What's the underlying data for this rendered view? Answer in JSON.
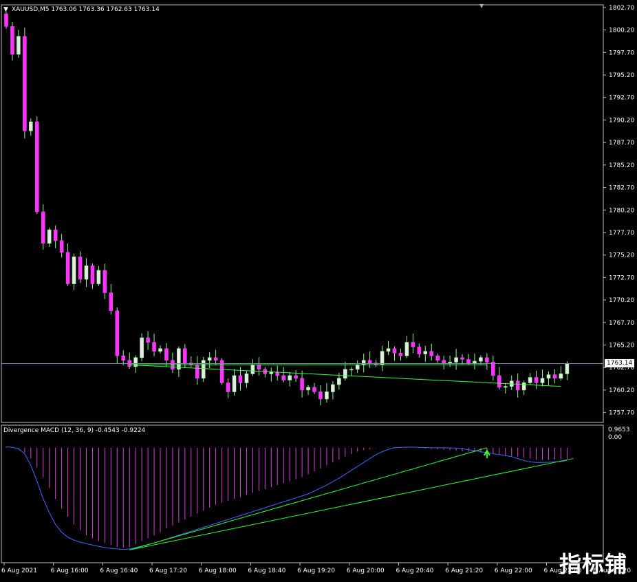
{
  "header": {
    "symbol_line": "XAUUSD,M5  1763.06 1763.36 1762.63 1763.14",
    "menu_icon": "triangle-down-icon"
  },
  "indicator": {
    "title": "Divergence MACD (12, 36, 9) -0.4543 -0.9224",
    "axis_top": "0.9653",
    "axis_zero": "0.00"
  },
  "price": {
    "current_label": "1763.14",
    "current_value": 1763.14
  },
  "watermark": "指标铺",
  "colors": {
    "bull": "#e8e8e8",
    "bull_outline": "#8cff8c",
    "bear": "#ff33ff",
    "wick": "#8cff8c",
    "trendline": "#33ff33",
    "signal": "#3d6bff",
    "histogram": "#e040e0",
    "price_line": "#7a8ca8",
    "arrow": "#33ff33",
    "frame": "#c0c0c0"
  },
  "chart_data": [
    {
      "type": "candlestick",
      "title": "XAUUSD,M5",
      "ylim": [
        1756.6,
        1803.0
      ],
      "yticks": [
        "1802.70",
        "1800.20",
        "1797.70",
        "1795.20",
        "1792.70",
        "1790.20",
        "1787.70",
        "1785.20",
        "1782.70",
        "1780.20",
        "1777.70",
        "1775.20",
        "1772.70",
        "1770.20",
        "1767.70",
        "1765.20",
        "1762.70",
        "1760.20",
        "1757.70"
      ],
      "xticks": [
        "6 Aug 2021",
        "6 Aug 16:00",
        "6 Aug 16:40",
        "6 Aug 17:20",
        "6 Aug 18:00",
        "6 Aug 18:40",
        "6 Aug 19:20",
        "6 Aug 20:00",
        "6 Aug 20:40",
        "6 Aug 21:20",
        "6 Aug 22:00",
        "6 Aug 22:40",
        "6 Aug 23:20"
      ],
      "closes": [
        1800.6,
        1797.5,
        1799.5,
        1789.0,
        1790.0,
        1780.0,
        1776.5,
        1778.0,
        1776.8,
        1775.5,
        1772.0,
        1775.0,
        1772.5,
        1774.0,
        1772.0,
        1773.5,
        1771.0,
        1769.0,
        1764.0,
        1763.5,
        1762.8,
        1763.8,
        1766.0,
        1765.5,
        1764.5,
        1764.8,
        1763.5,
        1762.5,
        1764.8,
        1763.2,
        1763.0,
        1761.5,
        1763.5,
        1763.8,
        1763.5,
        1761.0,
        1760.0,
        1761.8,
        1761.0,
        1762.0,
        1763.0,
        1762.5,
        1762.0,
        1762.2,
        1761.8,
        1761.3,
        1761.8,
        1761.5,
        1760.2,
        1760.5,
        1760.0,
        1759.2,
        1760.0,
        1760.8,
        1761.5,
        1762.5,
        1762.5,
        1763.0,
        1763.5,
        1763.2,
        1763.0,
        1764.5,
        1764.8,
        1764.3,
        1764.0,
        1765.5,
        1765.0,
        1764.2,
        1764.5,
        1764.0,
        1763.5,
        1763.2,
        1763.3,
        1763.8,
        1763.6,
        1763.2,
        1763.4,
        1763.8,
        1763.3,
        1761.8,
        1760.5,
        1760.6,
        1761.2,
        1760.2,
        1761.0,
        1761.6,
        1761.0,
        1761.5,
        1761.9,
        1761.5,
        1762.0,
        1763.14
      ],
      "trendlines": [
        {
          "from": [
            20,
            1763.0
          ],
          "to": [
            78,
            1763.0
          ]
        },
        {
          "from": [
            20,
            1763.0
          ],
          "to": [
            90,
            1760.6
          ]
        }
      ]
    },
    {
      "type": "macd",
      "title": "Divergence MACD (12, 36, 9)",
      "ylim": [
        -5.85,
        1.15
      ],
      "macd_histogram": [
        0.05,
        0.0,
        -0.08,
        -0.25,
        -0.55,
        -1.0,
        -1.5,
        -2.05,
        -2.6,
        -3.1,
        -3.5,
        -3.9,
        -4.2,
        -4.45,
        -4.6,
        -4.75,
        -4.85,
        -4.95,
        -5.05,
        -5.1,
        -5.05,
        -4.9,
        -4.75,
        -4.6,
        -4.45,
        -4.3,
        -4.1,
        -3.95,
        -3.8,
        -3.65,
        -3.5,
        -3.35,
        -3.2,
        -3.05,
        -2.9,
        -2.8,
        -2.7,
        -2.6,
        -2.5,
        -2.4,
        -2.3,
        -2.2,
        -2.1,
        -2.0,
        -1.9,
        -1.8,
        -1.7,
        -1.6,
        -1.5,
        -1.35,
        -1.2,
        -1.05,
        -0.9,
        -0.75,
        -0.6,
        -0.45,
        -0.32,
        -0.2,
        -0.12,
        -0.06,
        -0.02,
        0.0,
        0.02,
        0.03,
        0.03,
        0.02,
        0.0,
        -0.02,
        -0.04,
        -0.06,
        -0.08,
        -0.1,
        -0.12,
        -0.15,
        -0.18,
        -0.2,
        -0.22,
        -0.25,
        -0.27,
        -0.3,
        -0.35,
        -0.4,
        -0.42,
        -0.45,
        -0.5,
        -0.55,
        -0.6,
        -0.62,
        -0.62,
        -0.6,
        -0.58,
        -0.55
      ],
      "signal": [
        0.05,
        0.02,
        -0.05,
        -0.3,
        -0.9,
        -1.7,
        -2.6,
        -3.3,
        -3.9,
        -4.3,
        -4.55,
        -4.7,
        -4.8,
        -4.88,
        -4.95,
        -5.02,
        -5.08,
        -5.12,
        -5.15,
        -5.17,
        -5.15,
        -5.08,
        -5.0,
        -4.92,
        -4.85,
        -4.75,
        -4.65,
        -4.55,
        -4.45,
        -4.35,
        -4.25,
        -4.15,
        -4.05,
        -3.95,
        -3.85,
        -3.75,
        -3.65,
        -3.55,
        -3.45,
        -3.35,
        -3.25,
        -3.15,
        -3.05,
        -2.95,
        -2.85,
        -2.75,
        -2.65,
        -2.55,
        -2.45,
        -2.35,
        -2.2,
        -2.05,
        -1.9,
        -1.72,
        -1.55,
        -1.35,
        -1.15,
        -0.95,
        -0.75,
        -0.55,
        -0.35,
        -0.2,
        -0.08,
        0.0,
        0.02,
        0.03,
        0.03,
        0.02,
        0.01,
        0.0,
        0.0,
        0.0,
        -0.01,
        -0.02,
        -0.05,
        -0.1,
        -0.15,
        -0.2,
        -0.25,
        -0.3,
        -0.35,
        -0.4,
        -0.45,
        -0.55,
        -0.65,
        -0.72,
        -0.75,
        -0.75,
        -0.74,
        -0.72,
        -0.7,
        -0.65
      ],
      "trendlines": [
        {
          "from": [
            20,
            -5.2
          ],
          "to": [
            78,
            0.0
          ]
        },
        {
          "from": [
            20,
            -5.2
          ],
          "to": [
            92,
            -0.55
          ]
        }
      ],
      "arrows": [
        78,
        92
      ]
    }
  ]
}
